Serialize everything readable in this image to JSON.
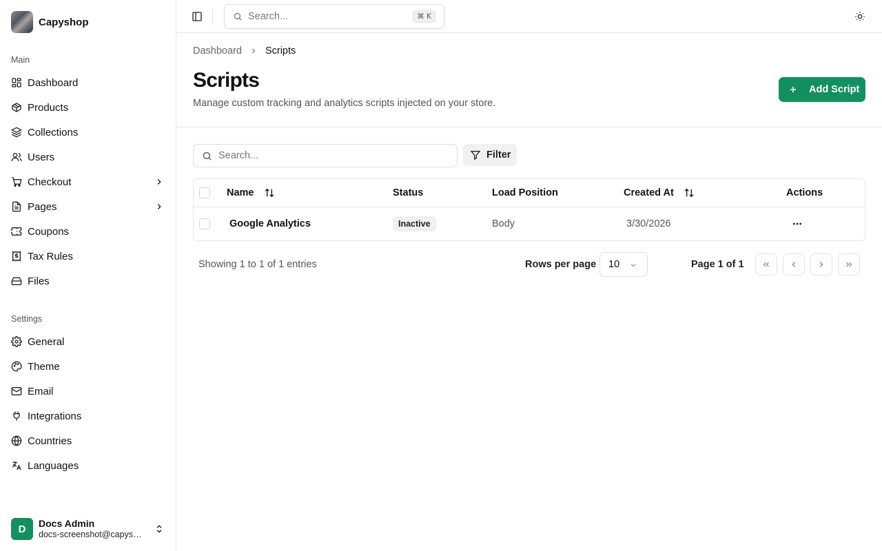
{
  "app": {
    "name": "Capyshop"
  },
  "sidebar": {
    "main_label": "Main",
    "main_items": [
      {
        "label": "Dashboard",
        "icon": "dashboard-icon"
      },
      {
        "label": "Products",
        "icon": "package-icon"
      },
      {
        "label": "Collections",
        "icon": "layers-icon"
      },
      {
        "label": "Users",
        "icon": "users-icon"
      },
      {
        "label": "Checkout",
        "icon": "cart-icon",
        "has_submenu": true
      },
      {
        "label": "Pages",
        "icon": "file-icon",
        "has_submenu": true
      },
      {
        "label": "Coupons",
        "icon": "ticket-icon"
      },
      {
        "label": "Tax Rules",
        "icon": "receipt-icon"
      },
      {
        "label": "Files",
        "icon": "hard-drive-icon"
      }
    ],
    "settings_label": "Settings",
    "settings_items": [
      {
        "label": "General",
        "icon": "gear-icon"
      },
      {
        "label": "Theme",
        "icon": "palette-icon"
      },
      {
        "label": "Email",
        "icon": "mail-icon"
      },
      {
        "label": "Integrations",
        "icon": "plug-icon"
      },
      {
        "label": "Countries",
        "icon": "globe-icon"
      },
      {
        "label": "Languages",
        "icon": "languages-icon"
      }
    ],
    "user": {
      "initial": "D",
      "name": "Docs Admin",
      "email": "docs-screenshot@capyshop.dev"
    }
  },
  "topbar": {
    "search_placeholder": "Search...",
    "shortcut": "⌘ K"
  },
  "breadcrumb": {
    "parent": "Dashboard",
    "current": "Scripts"
  },
  "page": {
    "title": "Scripts",
    "subtitle": "Manage custom tracking and analytics scripts injected on your store.",
    "add_button": "Add Script"
  },
  "toolbar": {
    "search_placeholder": "Search...",
    "filter_label": "Filter"
  },
  "table": {
    "columns": {
      "name": "Name",
      "status": "Status",
      "load_position": "Load Position",
      "created_at": "Created At",
      "actions": "Actions"
    },
    "rows": [
      {
        "name": "Google Analytics",
        "status": "Inactive",
        "load_position": "Body",
        "created_at": "3/30/2026"
      }
    ]
  },
  "pagination": {
    "showing": "Showing 1 to 1 of 1 entries",
    "rows_per_page_label": "Rows per page",
    "rows_per_page": "10",
    "page_label": "Page 1 of 1"
  },
  "colors": {
    "accent": "#12905f",
    "border": "#e5e5e5",
    "badge_bg": "#f0f0f0"
  }
}
